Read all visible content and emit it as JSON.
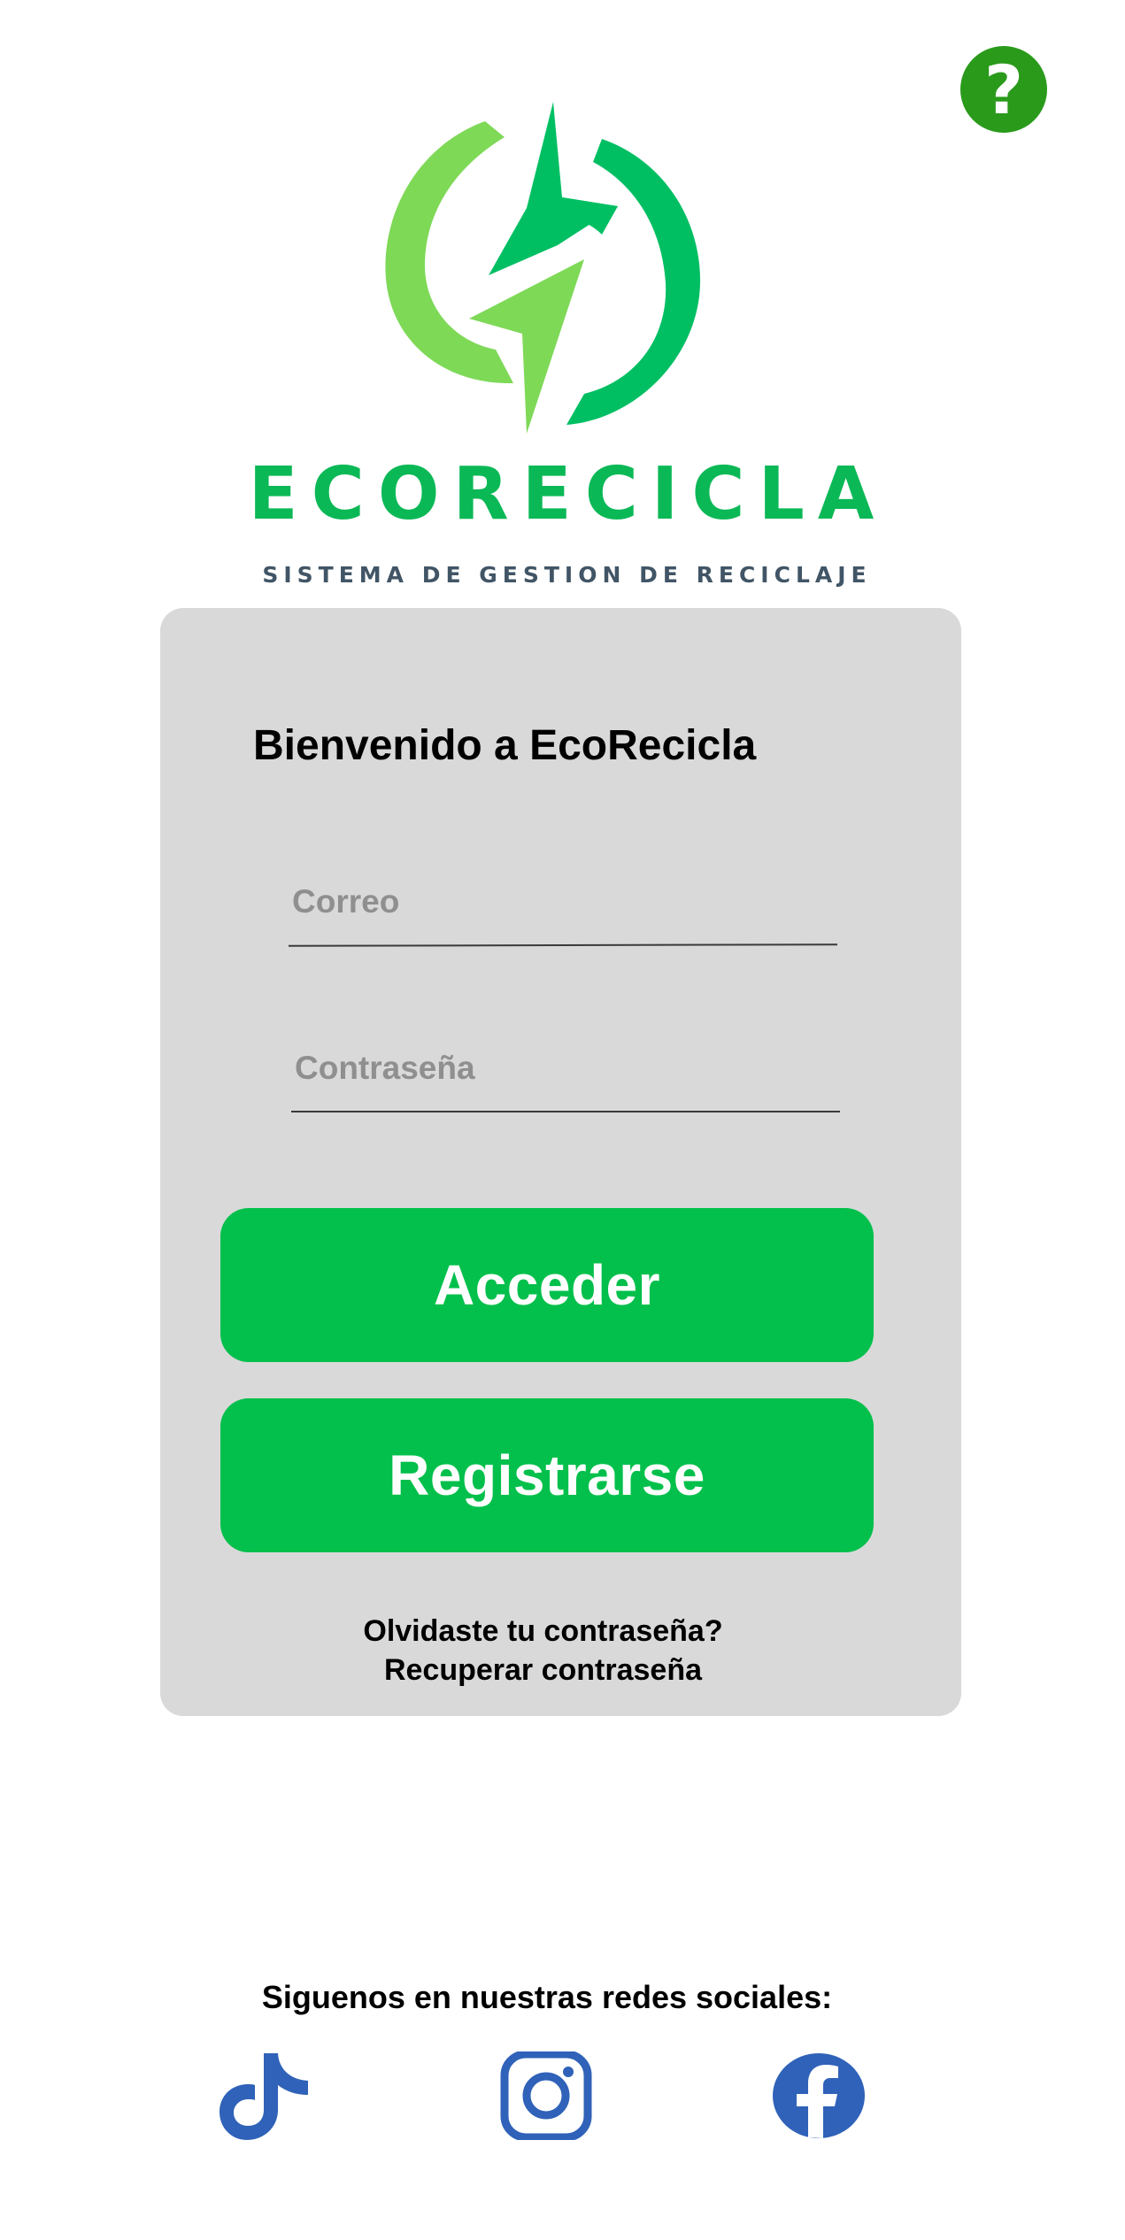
{
  "help": {
    "glyph": "?"
  },
  "brand": {
    "name": "ECORECICLA",
    "tagline": "SISTEMA DE GESTION DE RECICLAJE"
  },
  "login": {
    "title": "Bienvenido a EcoRecicla",
    "email_placeholder": "Correo",
    "password_placeholder": "Contraseña",
    "access_label": "Acceder",
    "register_label": "Registrarse",
    "forgot_text": "Olvidaste tu contraseña?",
    "recover_text": "Recuperar contraseña"
  },
  "social": {
    "heading": "Siguenos en nuestras redes sociales:",
    "icons": [
      "tiktok-icon",
      "instagram-icon",
      "facebook-icon"
    ]
  },
  "colors": {
    "primary_green": "#02c04b",
    "help_green": "#2a9a1b",
    "logo_light_green": "#7ed957",
    "logo_dark_green": "#00bf63",
    "social_blue": "#2f62b8",
    "card_gray": "#d9d9d9"
  }
}
